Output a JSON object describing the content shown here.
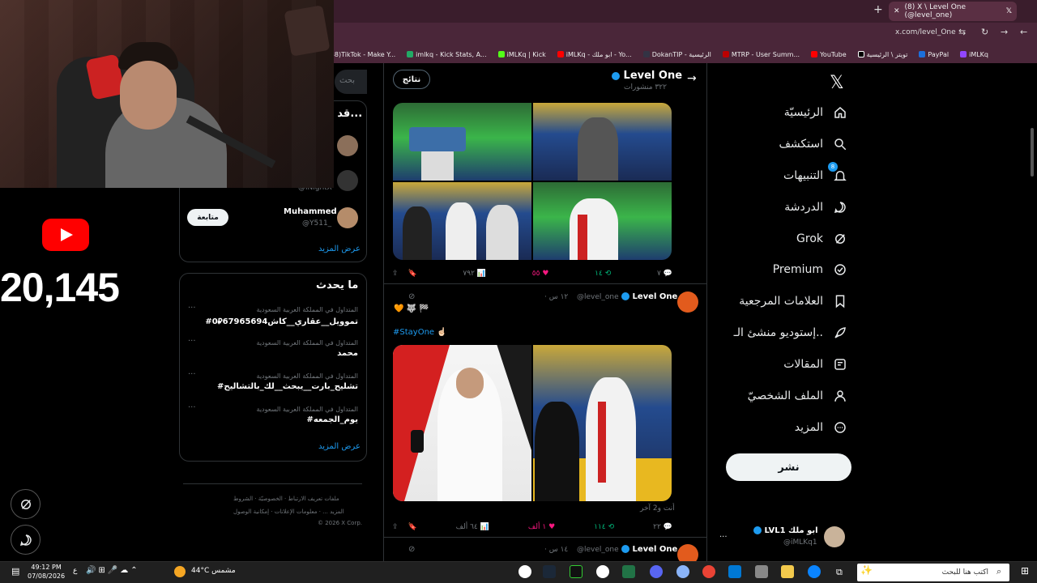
{
  "browser": {
    "tab_title": "(8) X \\ Level One (@level_one)",
    "url": "x.com/level_One",
    "bookmarks": [
      "iMLKq",
      "PayPal",
      "تويتر \\ الرئيسية",
      "YouTube",
      "MTRP - User Summ...",
      "DokanTIP - الرئيسية",
      "iMLKq - ابو ملك - Yo...",
      "iMLKq | Kick",
      "imlkq - Kick Stats, A...",
      "(38)TikTok - Make Y..."
    ]
  },
  "stream": {
    "sub_count": "20,145"
  },
  "nav": {
    "items": [
      {
        "label": "الرئيسيّة",
        "icon": "home-icon"
      },
      {
        "label": "استكشف",
        "icon": "search-icon"
      },
      {
        "label": "التنبيهات",
        "icon": "bell-icon",
        "badge": "8"
      },
      {
        "label": "الدردشة",
        "icon": "chat-icon"
      },
      {
        "label": "Grok",
        "icon": "grok-icon"
      },
      {
        "label": "Premium",
        "icon": "premium-icon"
      },
      {
        "label": "العلامات المرجعية",
        "icon": "bookmark-icon"
      },
      {
        "label": "إستوديو منشئ الـ..",
        "icon": "rocket-icon"
      },
      {
        "label": "المقالات",
        "icon": "article-icon"
      },
      {
        "label": "الملف الشخصيّ",
        "icon": "person-icon"
      },
      {
        "label": "المزيد",
        "icon": "more-icon"
      }
    ],
    "post_label": "نشر",
    "me": {
      "name": "LVL1 ابو ملك",
      "handle": "@iMLKq1",
      "more": "..."
    }
  },
  "profile_header": {
    "name": "Level One",
    "posts": "٣٢٢ منشورات",
    "results_button": "نتائج"
  },
  "tweets": [
    {
      "actions": {
        "replies": "٧",
        "reposts": "١٤",
        "likes": "٥٥",
        "views": "٧٩٢"
      }
    },
    {
      "name": "Level One",
      "handle": "@level_one",
      "time": "· ١٢ س",
      "emoji_line": "🧡 🐺 🏁",
      "text": "#StayOne ☝🏻",
      "caption": "أنت و2 آخر",
      "actions": {
        "replies": "٢٢",
        "reposts": "١١٤",
        "likes": "١ ألف",
        "views": "٦٤ ألف"
      }
    },
    {
      "name": "Level One",
      "handle": "@level_one",
      "time": "· ١٤ س"
    }
  ],
  "sidebar": {
    "search_placeholder": "بحث",
    "who_to_follow": {
      "title": "قد يع...",
      "users": [
        {
          "name": "",
          "handle": ""
        },
        {
          "name": "",
          "handle": "@iNightX"
        },
        {
          "name": "Muhammed",
          "handle": "@Y511_",
          "follow_label": "متابعة"
        }
      ],
      "show_more": "عرض المزيد"
    },
    "trends": {
      "title": "ما يحدث",
      "items": [
        {
          "meta": "المتداول في المملكة العربية السعودية",
          "name": "#تموويل__عقاري__كاش67965694⃁0"
        },
        {
          "meta": "المتداول في المملكة العربية السعودية",
          "name": "محمد"
        },
        {
          "meta": "المتداول في المملكة العربية السعودية",
          "name": "#تشليح_بارت__يبحث__لك_بالتشاليح"
        },
        {
          "meta": "المتداول في المملكة العربية السعودية",
          "name": "#يوم_الجمعه"
        }
      ],
      "show_more": "عرض المزيد"
    },
    "footer": {
      "line1": [
        "الشروط",
        "الخصوصيّة",
        "ملفات تعريف الارتباط"
      ],
      "line2": [
        "إمكانية الوصول",
        "معلومات الإعلانات",
        "المزيد ..."
      ],
      "line3": "© 2026 X Corp."
    }
  },
  "taskbar": {
    "search_placeholder": "اكتب هنا للبحث",
    "weather": "44°C مشمس",
    "time": "49:12 PM",
    "date": "07/08/2026",
    "lang": "ع"
  },
  "colors": {
    "accent": "#1d9bf0",
    "like": "#f91880",
    "repost": "#00ba7c",
    "chrome": "#4a2639"
  }
}
